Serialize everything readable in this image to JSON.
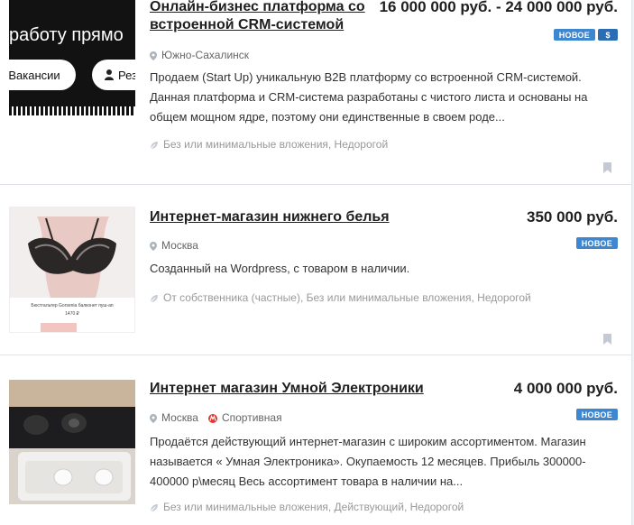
{
  "listings": [
    {
      "title_line1": "Онлайн-бизнес платформа со",
      "title_line2": "встроенной CRM-системой",
      "price": "16 000 000 руб. - 24 000 000 руб.",
      "badge": "НОВОЕ",
      "dollar_badge": "$",
      "city": "Южно-Сахалинск",
      "description": "Продаем (Start Up) уникальную B2B платформу со встроенной CRM-системой. Данная платформа и CRM-система разработаны с чистого листа и основаны на общем мощном ядре, поэтому они единственные в своем роде...",
      "tags": "Без или минимальные вложения, Недорогой",
      "thumb": {
        "text_top": "работу прямо",
        "btn_vacancies": "Вакансии",
        "btn_resume": "Рез"
      }
    },
    {
      "title": "Интернет-магазин нижнего белья",
      "price": "350 000 руб.",
      "badge": "НОВОЕ",
      "city": "Москва",
      "description": "Созданный на Wordpress, с товаром в наличии.",
      "tags": "От собственника (частные), Без или минимальные вложения, Недорогой",
      "thumb": {
        "caption": "Бюстгальтер Gorsenia балконет пуш-ап",
        "caption_price": "1470 ₽"
      }
    },
    {
      "title": "Интернет магазин Умной Электроники",
      "price": "4 000 000 руб.",
      "badge": "НОВОЕ",
      "city": "Москва",
      "metro": "Спортивная",
      "description": "Продаётся действующий интернет-магазин с широким ассортиментом. Магазин называется « Умная Электроника». Окупаемость 12 месяцев. Прибыль 300000-400000 р\\месяц Весь ассортимент товара в наличии на...",
      "tags": "Без или минимальные вложения, Действующий, Недорогой"
    }
  ],
  "colors": {
    "badge": "#3d86d0",
    "metro": "#e3342f",
    "text_muted": "#999999"
  },
  "icons": {
    "location": "pin-icon",
    "metro": "metro-icon",
    "tags": "leaf-icon",
    "bookmark": "bookmark-icon"
  }
}
